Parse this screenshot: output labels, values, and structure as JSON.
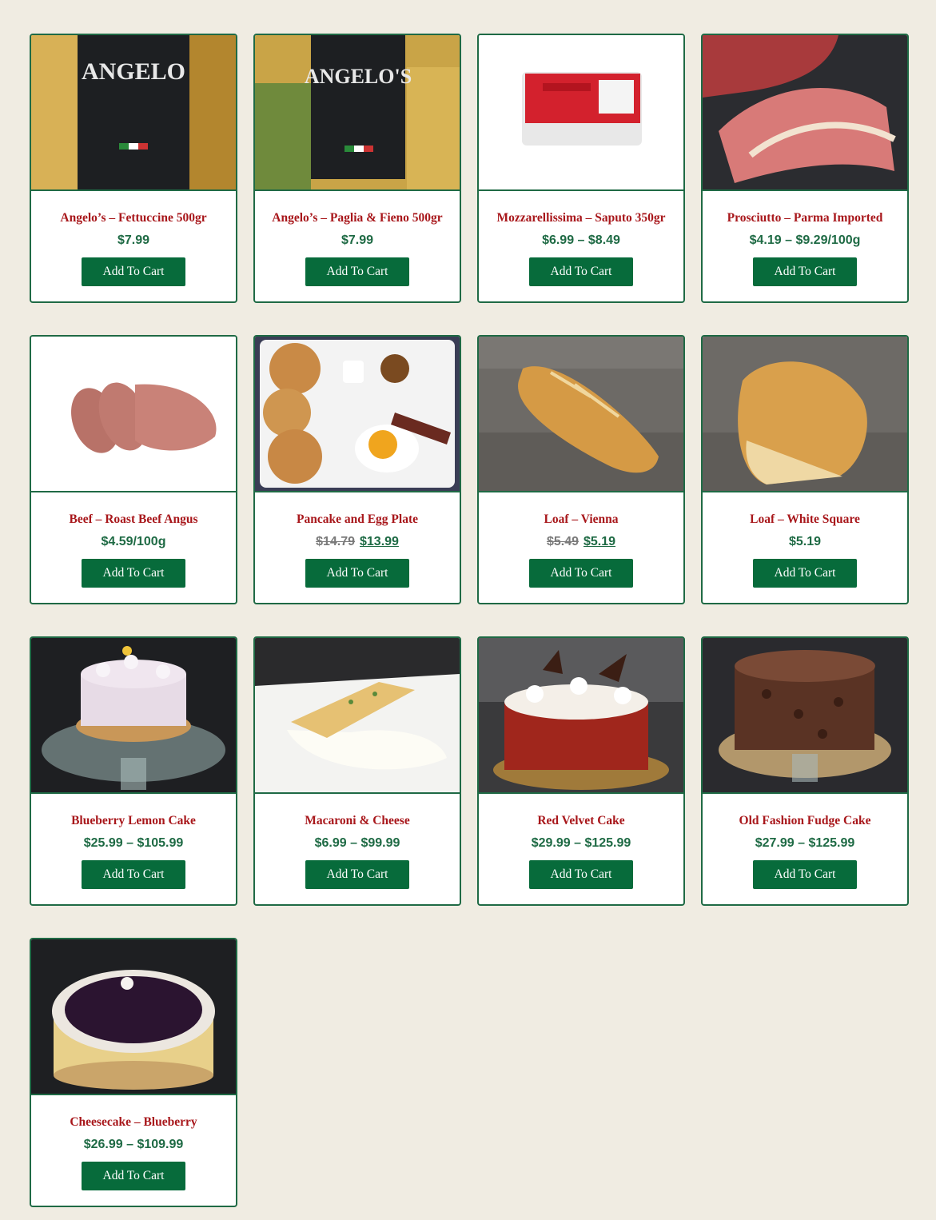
{
  "button_label": "Add To Cart",
  "products": [
    {
      "title": "Angelo’s – Fettuccine 500gr",
      "price": "$7.99",
      "image": "fettuccine-package"
    },
    {
      "title": "Angelo’s – Paglia & Fieno 500gr",
      "price": "$7.99",
      "image": "paglia-fieno-package"
    },
    {
      "title": "Mozzarellissima – Saputo 350gr",
      "price": "$6.99 – $8.49",
      "image": "mozzarella-package"
    },
    {
      "title": "Prosciutto – Parma Imported",
      "price": "$4.19 – $9.29/100g",
      "image": "prosciutto-slices"
    },
    {
      "title": "Beef – Roast Beef Angus",
      "price": "$4.59/100g",
      "image": "roast-beef-slices"
    },
    {
      "title": "Pancake and Egg Plate",
      "old_price": "$14.79",
      "sale_price": "$13.99",
      "image": "pancake-plate"
    },
    {
      "title": "Loaf – Vienna",
      "old_price": "$5.49",
      "sale_price": "$5.19",
      "image": "vienna-loaf"
    },
    {
      "title": "Loaf – White Square",
      "price": "$5.19",
      "image": "white-square-loaf"
    },
    {
      "title": "Blueberry Lemon Cake",
      "price": "$25.99 – $105.99",
      "image": "blueberry-lemon-cake"
    },
    {
      "title": "Macaroni & Cheese",
      "price": "$6.99 – $99.99",
      "image": "macaroni-cheese"
    },
    {
      "title": "Red Velvet Cake",
      "price": "$29.99 – $125.99",
      "image": "red-velvet-cake"
    },
    {
      "title": "Old Fashion Fudge Cake",
      "price": "$27.99 – $125.99",
      "image": "fudge-cake"
    },
    {
      "title": "Cheesecake – Blueberry",
      "price": "$26.99 – $109.99",
      "image": "blueberry-cheesecake"
    }
  ],
  "colors": {
    "background": "#f0ece2",
    "card_border": "#1f6a45",
    "title": "#a8171b",
    "price": "#1e6a44",
    "button": "#076b3b",
    "old_price": "#7a7a7a"
  }
}
